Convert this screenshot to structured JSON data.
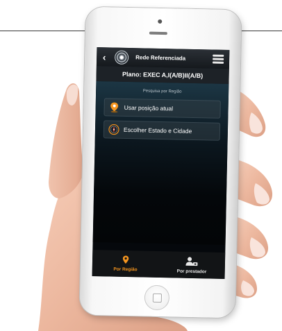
{
  "header": {
    "title": "Rede Referenciada",
    "back_icon": "back-arrow-icon",
    "menu_icon": "hamburger-menu-icon",
    "logo_icon": "company-logo-icon"
  },
  "plan": {
    "label": "Plano: EXEC A,I(A/B)II(A/B)"
  },
  "search": {
    "section_title": "Pesquisa por Região",
    "options": [
      {
        "label": "Usar posição atual",
        "icon": "location-pin-icon"
      },
      {
        "label": "Escolher Estado e Cidade",
        "icon": "compass-icon"
      }
    ]
  },
  "tabs": [
    {
      "label": "Por Região",
      "icon": "location-pin-icon",
      "active": true
    },
    {
      "label": "Por prestador",
      "icon": "user-icon",
      "active": false
    }
  ],
  "colors": {
    "accent": "#F5951F",
    "screen_bg": "#05080C",
    "text": "#FFFFFF"
  }
}
